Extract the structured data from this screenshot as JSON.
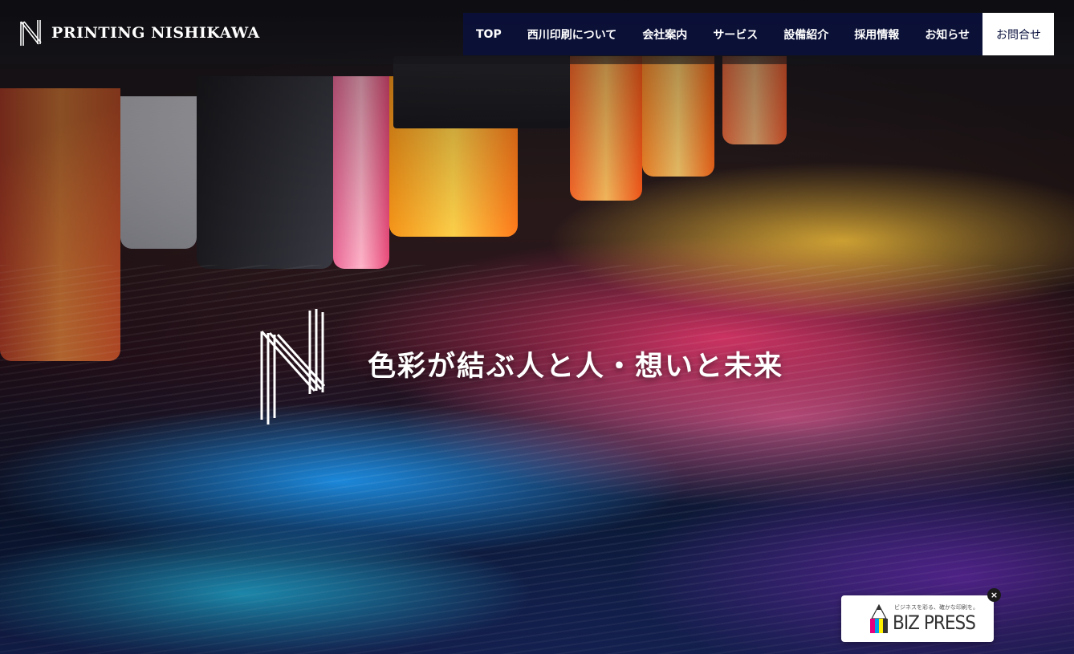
{
  "brand": {
    "logo_text": "PRINTING NISHIKAWA",
    "logo_icon": "n-logo-icon"
  },
  "nav": {
    "items": [
      {
        "label": "TOP"
      },
      {
        "label": "西川印刷について"
      },
      {
        "label": "会社案内"
      },
      {
        "label": "サービス"
      },
      {
        "label": "設備紹介"
      },
      {
        "label": "採用情報"
      },
      {
        "label": "お知らせ"
      }
    ],
    "contact_label": "お問合せ"
  },
  "hero": {
    "tagline": "色彩が結ぶ人と人・想いと未来",
    "emblem_icon": "n-emblem-icon"
  },
  "widget": {
    "subtitle": "ビジネスを彩る、確かな印刷を。",
    "title": "BIZ PRESS",
    "close_label": "×",
    "icon": "pencil-cmyk-icon"
  },
  "colors": {
    "nav_background": "#0a103c",
    "contact_background": "#ffffff",
    "contact_text": "#0d1440",
    "text": "#ffffff"
  }
}
